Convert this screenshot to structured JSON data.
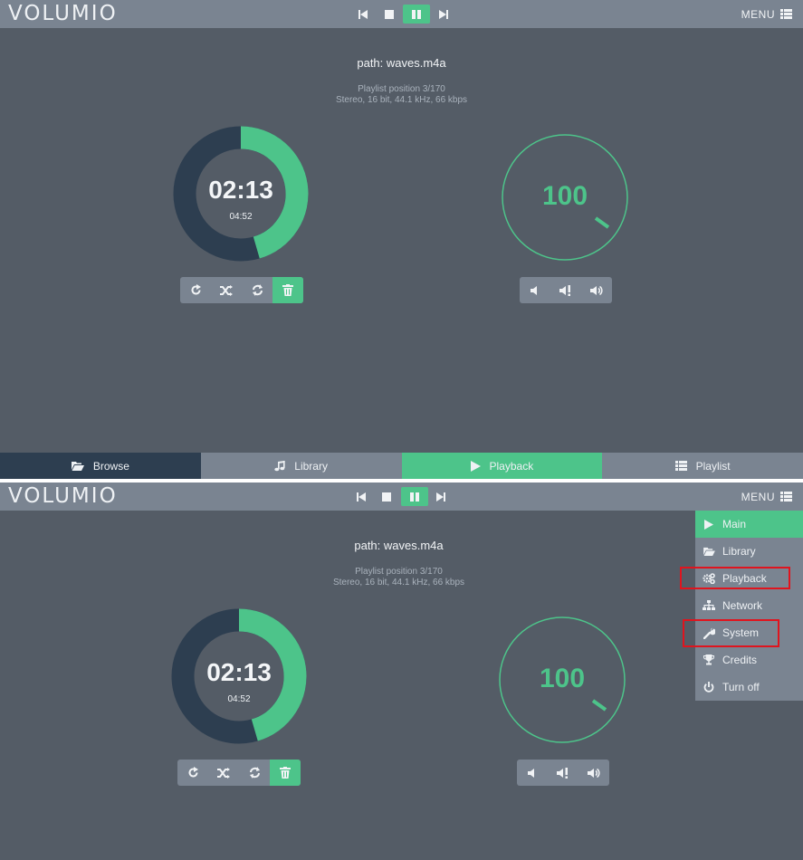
{
  "app": {
    "logo": "VOLUMIO",
    "menu_label": "MENU"
  },
  "player": {
    "path": "path: waves.m4a",
    "playlist_position": "Playlist position 3/170",
    "audio_info": "Stereo, 16 bit, 44.1 kHz, 66 kbps",
    "elapsed": "02:13",
    "total": "04:52",
    "progress_fraction": 0.455,
    "volume": "100"
  },
  "bottom_nav": {
    "browse": "Browse",
    "library": "Library",
    "playback": "Playback",
    "playlist": "Playlist"
  },
  "menu": {
    "items": [
      {
        "label": "Main",
        "icon": "play-icon"
      },
      {
        "label": "Library",
        "icon": "folder-icon"
      },
      {
        "label": "Playback",
        "icon": "cogs-icon"
      },
      {
        "label": "Network",
        "icon": "sitemap-icon"
      },
      {
        "label": "System",
        "icon": "wrench-icon"
      },
      {
        "label": "Credits",
        "icon": "trophy-icon"
      },
      {
        "label": "Turn off",
        "icon": "power-icon"
      }
    ]
  },
  "colors": {
    "background": "#545c66",
    "bar": "#7a8491",
    "accent": "#4dc48a",
    "ring_dark": "#2d3e50",
    "highlight": "#e0141e"
  }
}
